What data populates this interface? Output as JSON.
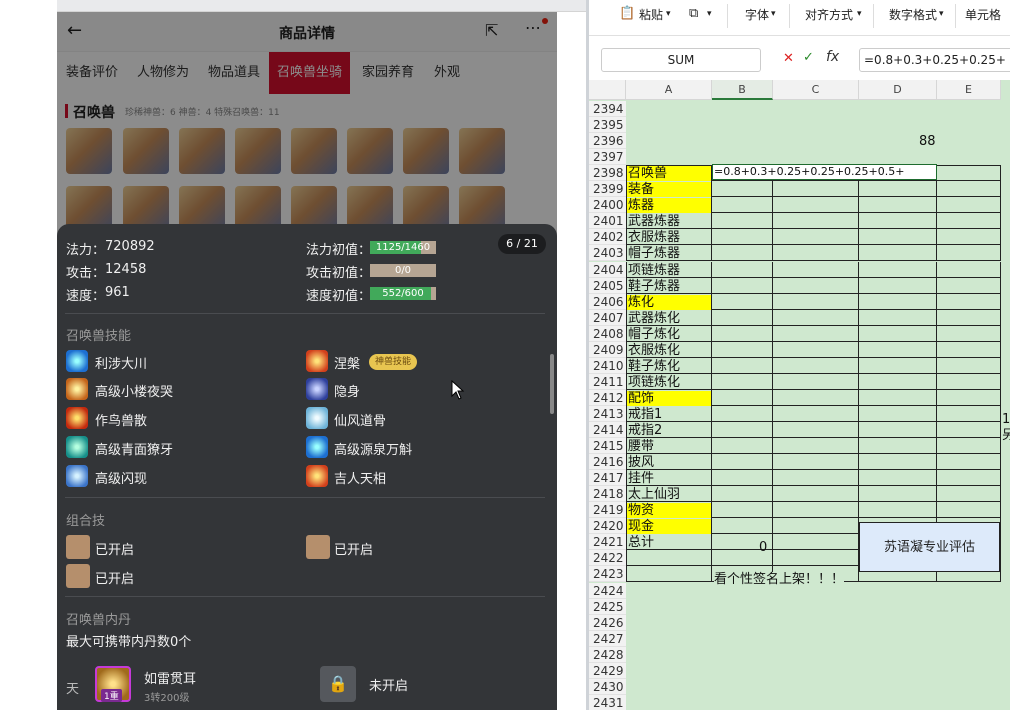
{
  "phone": {
    "title": "商品详情",
    "tabs": [
      "装备评价",
      "人物修为",
      "物品道具",
      "召唤兽坐骑",
      "家园养育",
      "外观"
    ],
    "active_tab": "召唤兽坐骑",
    "section_title": "召唤兽",
    "section_meta": "珍稀神兽：6   神兽：4   特殊召唤兽：11"
  },
  "popup": {
    "page_badge": "6 / 21",
    "stats": [
      {
        "label": "法力：",
        "value": "720892",
        "init_label": "法力初值：",
        "init_text": "1125/1460",
        "fill": 0.77
      },
      {
        "label": "攻击：",
        "value": "12458",
        "init_label": "攻击初值：",
        "init_text": "0/0",
        "fill": 0
      },
      {
        "label": "速度：",
        "value": "961",
        "init_label": "速度初值：",
        "init_text": "552/600",
        "fill": 0.92
      }
    ],
    "skills_title": "召唤兽技能",
    "skills": [
      "利涉大川",
      "涅槃",
      "高级小楼夜哭",
      "隐身",
      "作鸟兽散",
      "仙风道骨",
      "高级青面獠牙",
      "高级源泉万斛",
      "高级闪现",
      "吉人天相"
    ],
    "skill_tag": "神兽技能",
    "combo_title": "组合技",
    "combo": [
      "已开启",
      "已开启",
      "已开启"
    ],
    "neidan_title": "召唤兽内丹",
    "neidan_desc": "最大可携带内丹数0个",
    "neidan_tian": "天",
    "neidan_item": "如雷贯耳",
    "neidan_item_badge": "1重",
    "neidan_item_sub": "3转200级",
    "neidan_locked": "未开启"
  },
  "excel": {
    "ribbon": [
      "粘贴",
      "字体",
      "对齐方式",
      "数字格式",
      "单元格"
    ],
    "namebox": "SUM",
    "formula": "=0.8+0.3+0.25+0.25+",
    "columns": [
      "A",
      "B",
      "C",
      "D",
      "E"
    ],
    "rows": [
      {
        "n": "2394",
        "a": "",
        "yellow": false
      },
      {
        "n": "2395",
        "a": "",
        "yellow": false
      },
      {
        "n": "2396",
        "a": "",
        "yellow": false
      },
      {
        "n": "2397",
        "a": "",
        "yellow": false
      },
      {
        "n": "2398",
        "a": "召唤兽",
        "yellow": true
      },
      {
        "n": "2399",
        "a": "装备",
        "yellow": true
      },
      {
        "n": "2400",
        "a": "炼器",
        "yellow": true
      },
      {
        "n": "2401",
        "a": "武器炼器",
        "yellow": false
      },
      {
        "n": "2402",
        "a": "衣服炼器",
        "yellow": false
      },
      {
        "n": "2403",
        "a": "帽子炼器",
        "yellow": false
      },
      {
        "n": "2404",
        "a": "项链炼器",
        "yellow": false
      },
      {
        "n": "2405",
        "a": "鞋子炼器",
        "yellow": false
      },
      {
        "n": "2406",
        "a": "炼化",
        "yellow": true
      },
      {
        "n": "2407",
        "a": "武器炼化",
        "yellow": false
      },
      {
        "n": "2408",
        "a": "帽子炼化",
        "yellow": false
      },
      {
        "n": "2409",
        "a": "衣服炼化",
        "yellow": false
      },
      {
        "n": "2410",
        "a": "鞋子炼化",
        "yellow": false
      },
      {
        "n": "2411",
        "a": "项链炼化",
        "yellow": false
      },
      {
        "n": "2412",
        "a": "配饰",
        "yellow": true
      },
      {
        "n": "2413",
        "a": "戒指1",
        "yellow": false
      },
      {
        "n": "2414",
        "a": "戒指2",
        "yellow": false
      },
      {
        "n": "2415",
        "a": "腰带",
        "yellow": false
      },
      {
        "n": "2416",
        "a": "披风",
        "yellow": false
      },
      {
        "n": "2417",
        "a": "挂件",
        "yellow": false
      },
      {
        "n": "2418",
        "a": "太上仙羽",
        "yellow": false
      },
      {
        "n": "2419",
        "a": "物资",
        "yellow": true
      },
      {
        "n": "2420",
        "a": "现金",
        "yellow": true
      },
      {
        "n": "2421",
        "a": "总计",
        "yellow": false
      },
      {
        "n": "2422",
        "a": "",
        "yellow": false
      },
      {
        "n": "2423",
        "a": "",
        "yellow": false
      },
      {
        "n": "2424",
        "a": "",
        "yellow": false
      },
      {
        "n": "2425",
        "a": "",
        "yellow": false
      },
      {
        "n": "2426",
        "a": "",
        "yellow": false
      },
      {
        "n": "2427",
        "a": "",
        "yellow": false
      },
      {
        "n": "2428",
        "a": "",
        "yellow": false
      },
      {
        "n": "2429",
        "a": "",
        "yellow": false
      },
      {
        "n": "2430",
        "a": "",
        "yellow": false
      },
      {
        "n": "2431",
        "a": "",
        "yellow": false
      }
    ],
    "cell_d2396": "88",
    "cell_b2398": "=0.8+0.3+0.25+0.25+0.25+0.5+",
    "cell_b2421": "0",
    "cell_b2423": "看个性签名上架！！！",
    "eval_box": "苏语凝专业评估",
    "cell_e2413": "1",
    "cell_e2414": "另"
  }
}
